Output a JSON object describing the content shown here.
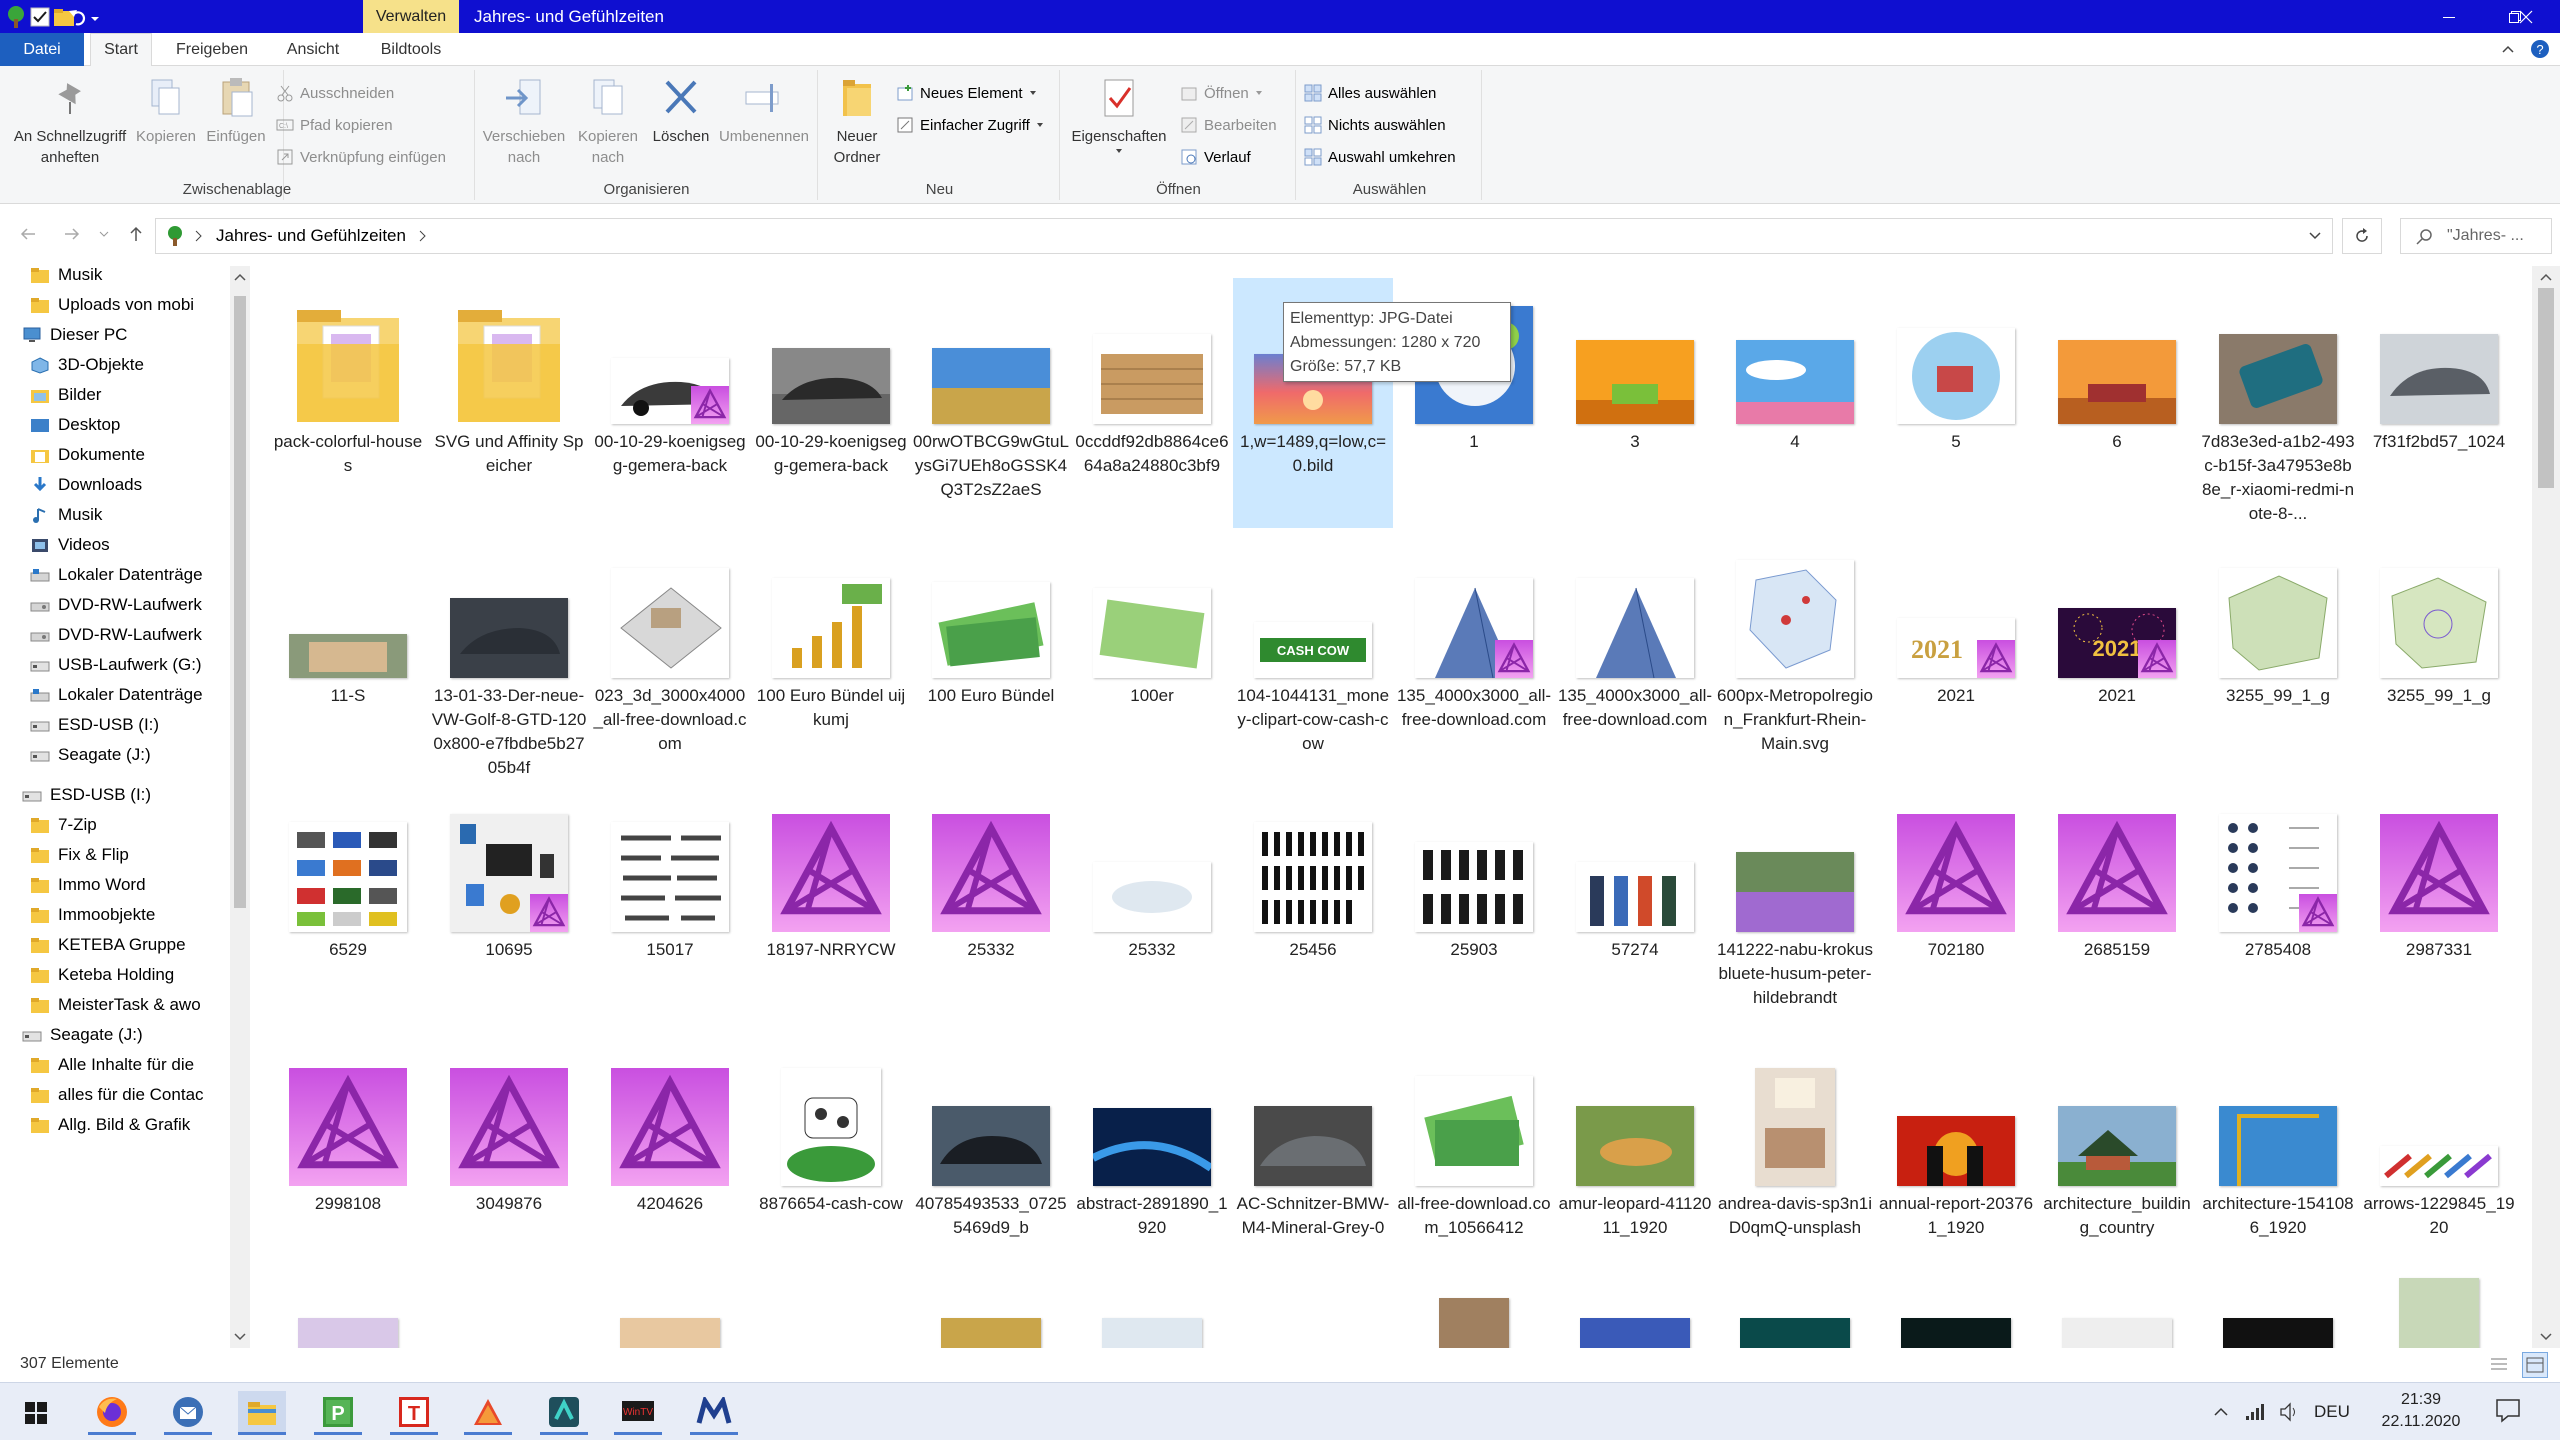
{
  "titlebar": {
    "context_tab": "Verwalten",
    "title": "Jahres- und Gefühlzeiten"
  },
  "tabs": {
    "datei": "Datei",
    "start": "Start",
    "freigeben": "Freigeben",
    "ansicht": "Ansicht",
    "bildtools": "Bildtools"
  },
  "ribbon": {
    "zwischenablage": {
      "title": "Zwischenablage",
      "pin_l1": "An Schnellzugriff",
      "pin_l2": "anheften",
      "kopieren": "Kopieren",
      "einfuegen": "Einfügen",
      "ausschneiden": "Ausschneiden",
      "pfad": "Pfad kopieren",
      "verknuepfung": "Verknüpfung einfügen"
    },
    "organisieren": {
      "title": "Organisieren",
      "verschieben_l1": "Verschieben",
      "verschieben_l2": "nach",
      "kopieren_l1": "Kopieren",
      "kopieren_l2": "nach",
      "loeschen": "Löschen",
      "umbenennen": "Umbenennen"
    },
    "neu": {
      "title": "Neu",
      "ordner_l1": "Neuer",
      "ordner_l2": "Ordner",
      "element": "Neues Element",
      "zugriff": "Einfacher Zugriff"
    },
    "oeffnen": {
      "title": "Öffnen",
      "eigenschaften": "Eigenschaften",
      "oeffnen": "Öffnen",
      "bearbeiten": "Bearbeiten",
      "verlauf": "Verlauf"
    },
    "auswaehlen": {
      "title": "Auswählen",
      "alle": "Alles auswählen",
      "nichts": "Nichts auswählen",
      "umkehren": "Auswahl umkehren"
    }
  },
  "address": {
    "path": "Jahres- und Gefühlzeiten",
    "search_placeholder": "\"Jahres- ..."
  },
  "nav": [
    {
      "label": "Musik",
      "icon": "folder-icon",
      "indent": 1
    },
    {
      "label": "Uploads von mobi",
      "icon": "folder-icon",
      "indent": 1
    },
    {
      "label": "Dieser PC",
      "icon": "pc-icon",
      "indent": 0
    },
    {
      "label": "3D-Objekte",
      "icon": "cube-icon",
      "indent": 1
    },
    {
      "label": "Bilder",
      "icon": "pictures-icon",
      "indent": 1
    },
    {
      "label": "Desktop",
      "icon": "desktop-icon",
      "indent": 1
    },
    {
      "label": "Dokumente",
      "icon": "documents-icon",
      "indent": 1
    },
    {
      "label": "Downloads",
      "icon": "download-icon",
      "indent": 1
    },
    {
      "label": "Musik",
      "icon": "music-icon",
      "indent": 1
    },
    {
      "label": "Videos",
      "icon": "video-icon",
      "indent": 1
    },
    {
      "label": "Lokaler Datenträge",
      "icon": "drive-icon",
      "indent": 1
    },
    {
      "label": "DVD-RW-Laufwerk",
      "icon": "dvd-icon",
      "indent": 1
    },
    {
      "label": "DVD-RW-Laufwerk",
      "icon": "dvd-icon",
      "indent": 1
    },
    {
      "label": "USB-Laufwerk (G:)",
      "icon": "usb-drive-icon",
      "indent": 1
    },
    {
      "label": "Lokaler Datenträge",
      "icon": "drive-icon",
      "indent": 1
    },
    {
      "label": "ESD-USB (I:)",
      "icon": "usb-drive-icon",
      "indent": 1
    },
    {
      "label": "Seagate (J:)",
      "icon": "usb-drive-icon",
      "indent": 1
    },
    {
      "label": "ESD-USB (I:)",
      "icon": "usb-drive-icon",
      "indent": 0
    },
    {
      "label": "7-Zip",
      "icon": "folder-icon",
      "indent": 1
    },
    {
      "label": "Fix & Flip",
      "icon": "folder-icon",
      "indent": 1
    },
    {
      "label": "Immo Word",
      "icon": "folder-icon",
      "indent": 1
    },
    {
      "label": "Immoobjekte",
      "icon": "folder-icon",
      "indent": 1
    },
    {
      "label": "KETEBA Gruppe",
      "icon": "folder-icon",
      "indent": 1
    },
    {
      "label": "Keteba Holding",
      "icon": "folder-icon",
      "indent": 1
    },
    {
      "label": "MeisterTask & awo",
      "icon": "folder-icon",
      "indent": 1
    },
    {
      "label": "Seagate (J:)",
      "icon": "usb-drive-icon",
      "indent": 0
    },
    {
      "label": "Alle Inhalte für die",
      "icon": "folder-icon",
      "indent": 1
    },
    {
      "label": "alles für die Contac",
      "icon": "folder-icon",
      "indent": 1
    },
    {
      "label": "Allg. Bild & Grafik",
      "icon": "folder-icon",
      "indent": 1
    }
  ],
  "files": [
    {
      "name": "pack-colorful-houses",
      "kind": "folder"
    },
    {
      "name": "SVG und Affinity Speicher",
      "kind": "folder"
    },
    {
      "name": "00-10-29-koenigsegg-gemera-back",
      "kind": "car-white",
      "badge": true
    },
    {
      "name": "00-10-29-koenigsegg-gemera-back",
      "kind": "car"
    },
    {
      "name": "00rwOTBCG9wGtuLysGi7UEh8oGSSK4Q3T2sZ2aeS",
      "kind": "field"
    },
    {
      "name": "0ccddf92db8864ce664a8a24880c3bf9",
      "kind": "wood"
    },
    {
      "name": "1,w=1489,q=low,c=0.bild",
      "kind": "sunset",
      "selected": true
    },
    {
      "name": "1",
      "kind": "blue-white"
    },
    {
      "name": "3",
      "kind": "orange-room"
    },
    {
      "name": "4",
      "kind": "sky-flowers"
    },
    {
      "name": "5",
      "kind": "winter"
    },
    {
      "name": "6",
      "kind": "orange-room2"
    },
    {
      "name": "7d83e3ed-a1b2-493c-b15f-3a47953e8b8e_r-xiaomi-redmi-note-8-...",
      "kind": "phone"
    },
    {
      "name": "7f31f2bd57_1024",
      "kind": "bmw"
    },
    {
      "name": "11-S",
      "kind": "house"
    },
    {
      "name": "13-01-33-Der-neue-VW-Golf-8-GTD-1200x800-e7fbdbe5b2705b4f",
      "kind": "golf"
    },
    {
      "name": "023_3d_3000x4000_all-free-download.com",
      "kind": "plan"
    },
    {
      "name": "100 Euro Bündel uijkumj",
      "kind": "money-chart"
    },
    {
      "name": "100 Euro Bündel",
      "kind": "money"
    },
    {
      "name": "100er",
      "kind": "money2"
    },
    {
      "name": "104-1044131_money-clipart-cow-cash-cow",
      "kind": "cashcow"
    },
    {
      "name": "135_4000x3000_all-free-download.com",
      "kind": "tower",
      "badge": true
    },
    {
      "name": "135_4000x3000_all-free-download.com",
      "kind": "tower"
    },
    {
      "name": "600px-Metropolregion_Frankfurt-Rhein-Main.svg",
      "kind": "map"
    },
    {
      "name": "2021",
      "kind": "text2021",
      "badge": true
    },
    {
      "name": "2021",
      "kind": "fireworks",
      "badge": true
    },
    {
      "name": "3255_99_1_g",
      "kind": "map2"
    },
    {
      "name": "3255_99_1_g",
      "kind": "map3"
    },
    {
      "name": "6529",
      "kind": "cars-icons"
    },
    {
      "name": "10695",
      "kind": "tech-icons",
      "badge": true
    },
    {
      "name": "15017",
      "kind": "guns"
    },
    {
      "name": "18197-NRRYCW",
      "kind": "affinity"
    },
    {
      "name": "25332",
      "kind": "affinity"
    },
    {
      "name": "25332",
      "kind": "dots"
    },
    {
      "name": "25456",
      "kind": "silhouettes"
    },
    {
      "name": "25903",
      "kind": "people-dark"
    },
    {
      "name": "57274",
      "kind": "people-color"
    },
    {
      "name": "141222-nabu-krokusbluete-husum-peter-hildebrandt",
      "kind": "crocus"
    },
    {
      "name": "702180",
      "kind": "affinity"
    },
    {
      "name": "2685159",
      "kind": "affinity"
    },
    {
      "name": "2785408",
      "kind": "contact-icons",
      "badge": true
    },
    {
      "name": "2987331",
      "kind": "affinity"
    },
    {
      "name": "2998108",
      "kind": "affinity"
    },
    {
      "name": "3049876",
      "kind": "affinity"
    },
    {
      "name": "4204626",
      "kind": "affinity"
    },
    {
      "name": "8876654-cash-cow",
      "kind": "cow2"
    },
    {
      "name": "40785493533_07255469d9_b",
      "kind": "bmw2"
    },
    {
      "name": "abstract-2891890_1920",
      "kind": "abstract"
    },
    {
      "name": "AC-Schnitzer-BMW-M4-Mineral-Grey-0",
      "kind": "bmw3"
    },
    {
      "name": "all-free-download.com_10566412",
      "kind": "money3"
    },
    {
      "name": "amur-leopard-4112011_1920",
      "kind": "leopard"
    },
    {
      "name": "andrea-davis-sp3n1iD0qmQ-unsplash",
      "kind": "kitchen"
    },
    {
      "name": "annual-report-203761_1920",
      "kind": "silhouette-red"
    },
    {
      "name": "architecture_building_country",
      "kind": "farmhouse"
    },
    {
      "name": "architecture-1541086_1920",
      "kind": "crane"
    },
    {
      "name": "arrows-1229845_1920",
      "kind": "arrows"
    }
  ],
  "tooltip": {
    "l1": "Elementtyp: JPG-Datei",
    "l2": "Abmessungen: 1280 x 720",
    "l3": "Größe: 57,7 KB"
  },
  "status": {
    "count": "307 Elemente"
  },
  "taskbar": {
    "lang": "DEU",
    "time": "21:39",
    "date": "22.11.2020"
  },
  "colors": {
    "titlebar": "#0f0fd0",
    "file_tab": "#1d5fbf",
    "selection": "#cce8ff",
    "affinity_top": "#c94fe0",
    "affinity_bottom": "#f3a2f1"
  }
}
